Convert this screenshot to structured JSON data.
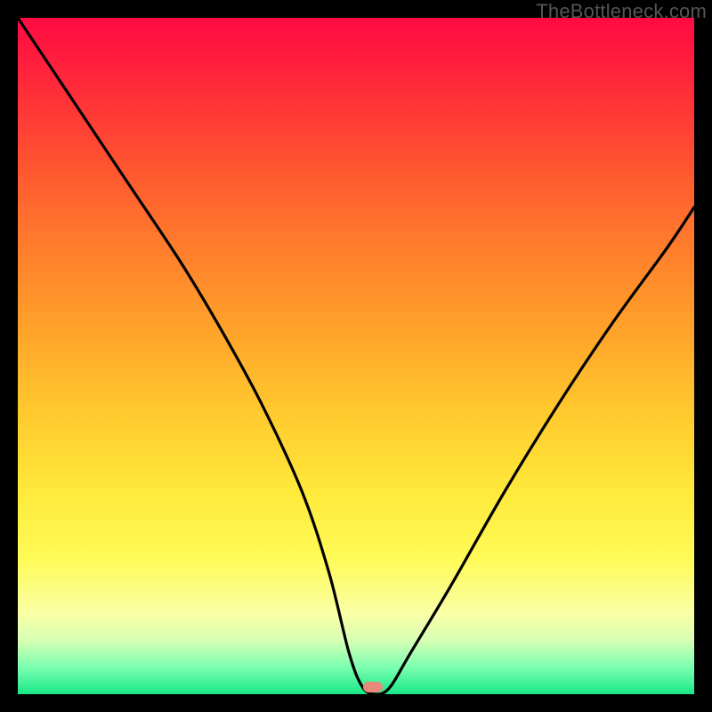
{
  "watermark": "TheBottleneck.com",
  "marker": {
    "x_pct": 52.5,
    "y_pct": 99.0
  },
  "chart_data": {
    "type": "line",
    "title": "",
    "xlabel": "",
    "ylabel": "",
    "xlim": [
      0,
      100
    ],
    "ylim": [
      0,
      100
    ],
    "series": [
      {
        "name": "bottleneck-curve",
        "x": [
          0,
          8,
          16,
          24,
          30,
          36,
          42,
          46,
          49,
          51,
          53,
          55,
          58,
          64,
          72,
          80,
          88,
          96,
          100
        ],
        "y": [
          100,
          88,
          76,
          64,
          54,
          43,
          30,
          18,
          6,
          1,
          0,
          1,
          6,
          16,
          30,
          43,
          55,
          66,
          72
        ]
      }
    ],
    "annotations": [
      {
        "type": "marker",
        "x": 52.5,
        "y": 1.0,
        "label": "optimal-point"
      }
    ],
    "background_gradient": {
      "top": "#ff0a43",
      "mid": "#ffd23a",
      "bottom": "#19e787"
    }
  }
}
